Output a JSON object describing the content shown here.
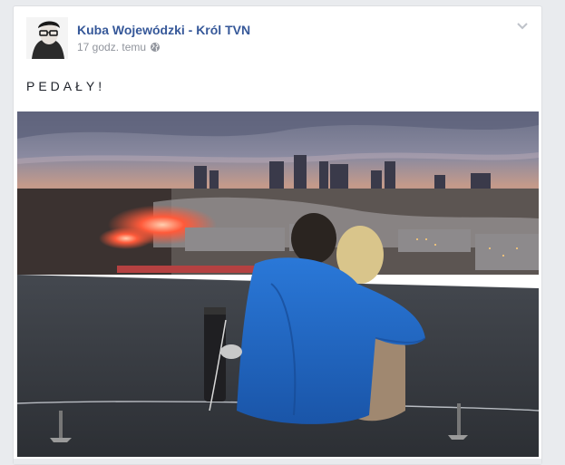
{
  "post": {
    "author": "Kuba Wojewódzki - Król TVN",
    "timestamp": "17 godz. temu",
    "privacy_icon": "globe-icon",
    "text": "PEDAŁY!",
    "menu_icon": "chevron-down-icon"
  },
  "colors": {
    "author_link": "#365899",
    "meta_gray": "#90949c",
    "background": "#e9ebee"
  }
}
